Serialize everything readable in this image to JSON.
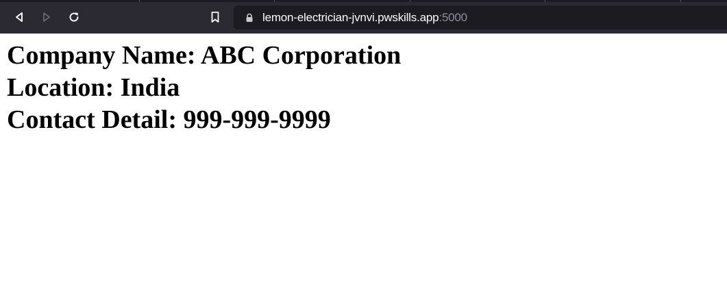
{
  "browser": {
    "url_host": "lemon-electrician-jvnvi.pwskills.app",
    "url_port": ":5000",
    "buttons": {
      "back": "back-icon",
      "forward": "forward-icon",
      "reload": "reload-icon",
      "bookmark": "bookmark-icon",
      "lock": "lock-icon"
    }
  },
  "page": {
    "lines": [
      "Company Name: ABC Corporation",
      "Location: India",
      "Contact Detail: 999-999-9999"
    ]
  },
  "colors": {
    "toolbar_bg": "#2b2a33",
    "urlbar_bg": "#1c1b22",
    "text": "#000000"
  }
}
